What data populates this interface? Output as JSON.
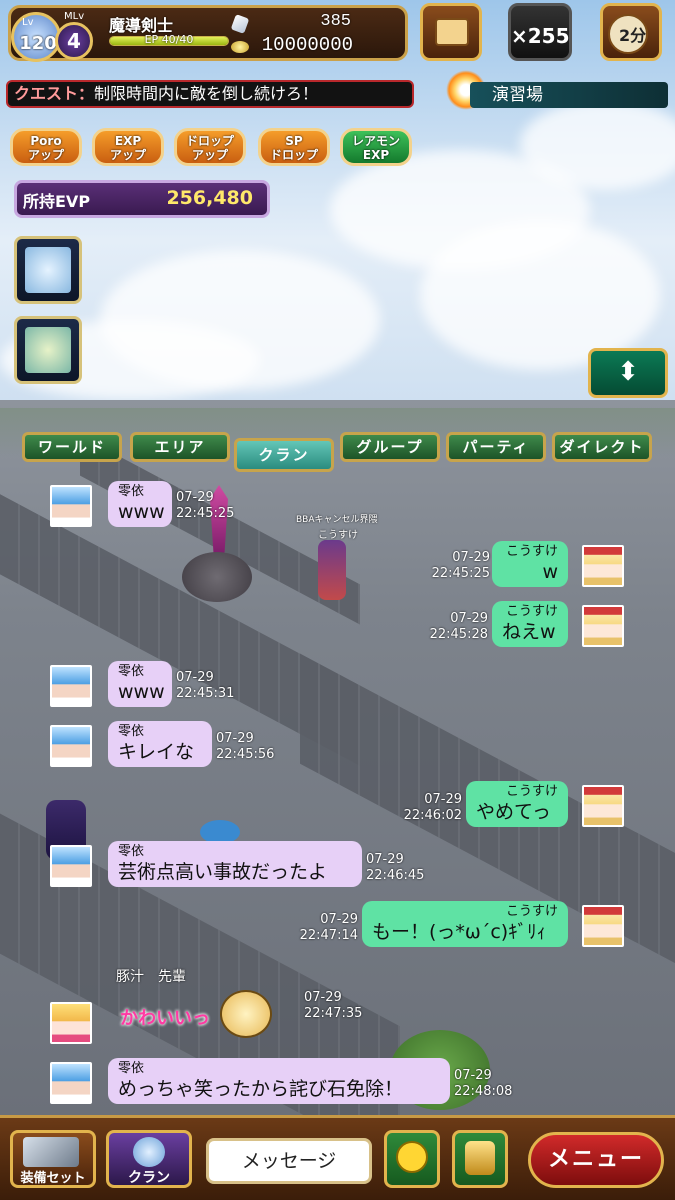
{
  "status": {
    "lv_label": "Lv",
    "lv": "120",
    "mlv_label": "MLv",
    "mlv": "4",
    "job": "魔導剣士",
    "ep_label": "EP",
    "ep": "40/40",
    "crystals": "385",
    "coins": "10000000"
  },
  "top_buttons": {
    "count": "×255",
    "timer": "2分"
  },
  "quest": {
    "label": "クエスト：",
    "text": "制限時間内に敵を倒し続けろ！"
  },
  "area_name": "演習場",
  "buffs": [
    {
      "line1": "Poro",
      "line2": "アップ"
    },
    {
      "line1": "EXP",
      "line2": "アップ"
    },
    {
      "line1": "ドロップ",
      "line2": "アップ"
    },
    {
      "line1": "SP",
      "line2": "ドロップ"
    },
    {
      "line1": "レアモン",
      "line2": "EXP"
    }
  ],
  "evp": {
    "label": "所持EVP",
    "value": "256,480"
  },
  "chat_tabs": [
    "ワールド",
    "エリア",
    "クラン",
    "グループ",
    "パーティ",
    "ダイレクト"
  ],
  "active_tab": "クラン",
  "world_labels": {
    "player_tag": "BBAキャンセル界隈",
    "player_name": "こうすけ"
  },
  "messages": [
    {
      "side": "left",
      "name": "零依",
      "text": "www",
      "date": "07-29",
      "time": "22:45:25"
    },
    {
      "side": "right",
      "name": "こうすけ",
      "text": "w",
      "date": "07-29",
      "time": "22:45:25"
    },
    {
      "side": "right",
      "name": "こうすけ",
      "text": "ねえw",
      "date": "07-29",
      "time": "22:45:28"
    },
    {
      "side": "left",
      "name": "零依",
      "text": "www",
      "date": "07-29",
      "time": "22:45:31"
    },
    {
      "side": "left",
      "name": "零依",
      "text": "キレイな",
      "date": "07-29",
      "time": "22:45:56"
    },
    {
      "side": "right",
      "name": "こうすけ",
      "text": "やめてっ",
      "date": "07-29",
      "time": "22:46:02"
    },
    {
      "side": "left",
      "name": "零依",
      "text": "芸術点高い事故だったよ",
      "date": "07-29",
      "time": "22:46:45"
    },
    {
      "side": "right",
      "name": "こうすけ",
      "text": "もー！(っ*ω´c)ｷﾞﾘｨ",
      "date": "07-29",
      "time": "22:47:14"
    },
    {
      "side": "left",
      "name": "豚汁　先輩",
      "text": "かわいいっ",
      "date": "07-29",
      "time": "22:47:35"
    },
    {
      "side": "left",
      "name": "零依",
      "text": "めっちゃ笑ったから詫び石免除！",
      "date": "07-29",
      "time": "22:48:08"
    }
  ],
  "bottom": {
    "equip": "装備セット",
    "clan": "クラン",
    "message": "メッセージ",
    "menu": "メニュー"
  }
}
